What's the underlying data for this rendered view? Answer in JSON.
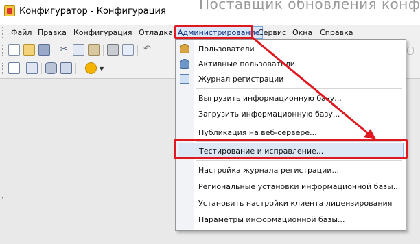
{
  "window": {
    "title": "Конфигуратор - Конфигурация",
    "background_ghost_text": "Поставщик обновления конфигур"
  },
  "menubar": {
    "items": [
      {
        "label": "Файл"
      },
      {
        "label": "Правка"
      },
      {
        "label": "Конфигурация"
      },
      {
        "label": "Отладка"
      },
      {
        "label": "Администрирование",
        "active": true
      },
      {
        "label": "Сервис"
      },
      {
        "label": "Окна"
      },
      {
        "label": "Справка"
      }
    ]
  },
  "toolbar": {
    "row1_icons": [
      "new-document-icon",
      "open-folder-icon",
      "save-icon",
      "cut-icon",
      "copy-icon",
      "paste-icon",
      "print-icon",
      "print-preview-icon",
      "undo-icon"
    ],
    "row2_icons": [
      "table-icon",
      "grid-icon",
      "database-icon",
      "window-icon",
      "run-icon"
    ]
  },
  "dropdown": {
    "items": [
      {
        "label": "Пользователи",
        "icon": "user-icon"
      },
      {
        "label": "Активные пользователи",
        "icon": "active-users-icon"
      },
      {
        "label": "Журнал регистрации",
        "icon": "journal-icon"
      },
      {
        "label": "Выгрузить информационную базу..."
      },
      {
        "label": "Загрузить информационную базу..."
      },
      {
        "label": "Публикация на веб-сервере..."
      },
      {
        "label": "Тестирование и исправление...",
        "selected": true
      },
      {
        "label": "Настройка журнала регистрации..."
      },
      {
        "label": "Региональные установки информационной базы..."
      },
      {
        "label": "Установить настройки клиента лицензирования"
      },
      {
        "label": "Параметры информационной базы..."
      }
    ]
  },
  "annotation": {
    "highlight_color": "#e0181f"
  }
}
